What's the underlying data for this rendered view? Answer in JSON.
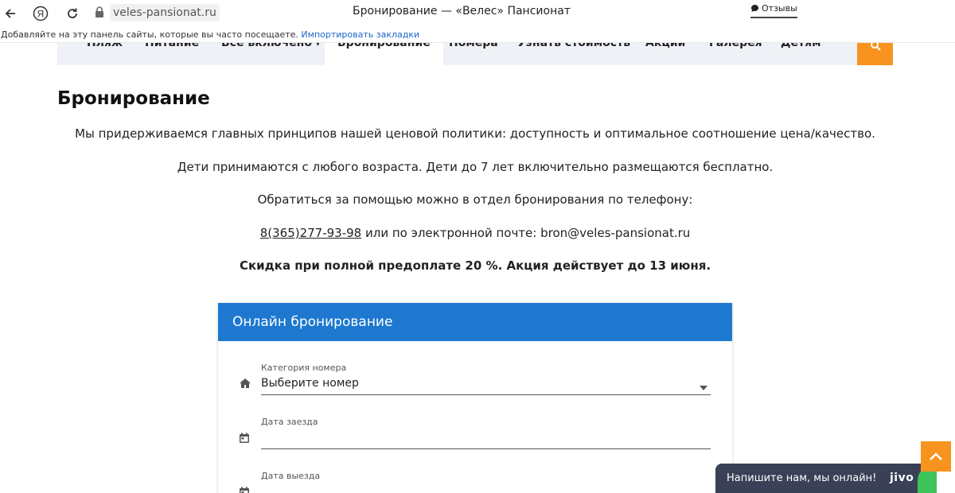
{
  "browser": {
    "url": "veles-pansionat.ru",
    "tab_title": "Бронирование — «Велес» Пансионат",
    "reviews_label": "Отзывы",
    "bookmarks_hint": "Добавляйте на эту панель сайты, которые вы часто посещаете.",
    "import_bookmarks": "Импортировать закладки"
  },
  "site_nav": {
    "items": [
      {
        "label": "Пляж"
      },
      {
        "label": "Питание"
      },
      {
        "label": "Всё включено"
      },
      {
        "label": "Бронирование"
      },
      {
        "label": "Номера"
      },
      {
        "label": "Узнать стоимость"
      },
      {
        "label": "Акции"
      },
      {
        "label": "Галерея"
      },
      {
        "label": "Детям"
      }
    ],
    "active_item": "Бронирование",
    "accent_color": "#f7931e"
  },
  "page": {
    "title": "Бронирование",
    "paragraph1": "Мы придерживаемся главных принципов нашей ценовой политики: доступность и оптимальное соотношение цена/качество.",
    "paragraph2": "Дети принимаются с любого возраста. Дети до 7 лет включительно размещаются бесплатно.",
    "paragraph3": "Обратиться за помощью можно в отдел бронирования по телефону:",
    "phone": "8(365)277-93-98",
    "contact_rest": " или по электронной почте: bron@veles-pansionat.ru",
    "discount": "Скидка при полной предоплате 20 %. Акция действует до 13 июня."
  },
  "booking": {
    "header": "Онлайн бронирование",
    "header_color": "#1e78d0",
    "room_category_label": "Категория номера",
    "room_category_value": "Выберите номер",
    "checkin_label": "Дата заезда",
    "checkout_label": "Дата выезда"
  },
  "chat": {
    "text": "Напишите нам, мы онлайн!",
    "brand": "jivo"
  }
}
